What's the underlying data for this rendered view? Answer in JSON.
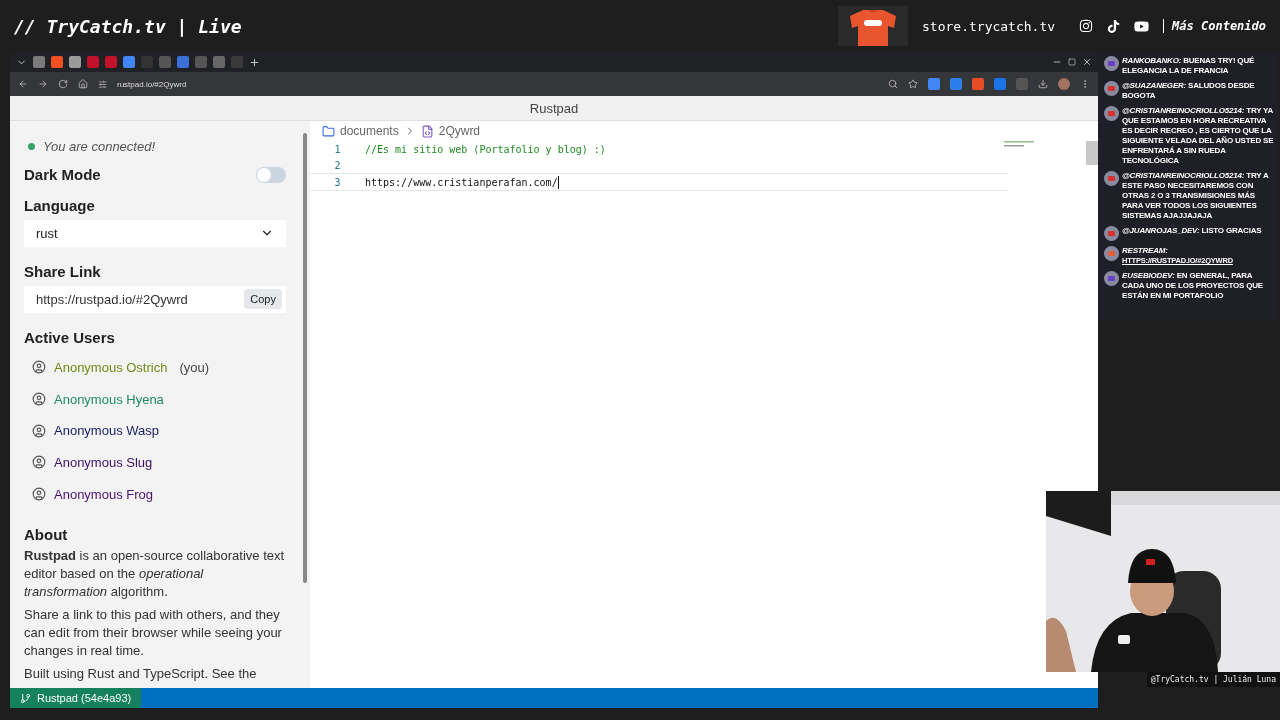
{
  "stream_header": {
    "title": "// TryCatch.tv | Live",
    "store": "store.trycatch.tv",
    "more": "Más Contenido"
  },
  "browser": {
    "address": "rustpad.io/#2Qywrd",
    "page_title": "Rustpad"
  },
  "sidebar": {
    "connection": {
      "text": "You are connected!",
      "connected": true
    },
    "dark_mode": {
      "label": "Dark Mode",
      "on": false
    },
    "language": {
      "label": "Language",
      "value": "rust"
    },
    "share_link": {
      "label": "Share Link",
      "value": "https://rustpad.io/#2Qywrd",
      "button": "Copy"
    },
    "active_users": {
      "label": "Active Users",
      "users": [
        {
          "name": "Anonymous Ostrich",
          "suffix": "(you)",
          "color": "#6e8a14"
        },
        {
          "name": "Anonymous Hyena",
          "color": "#1f8a6c"
        },
        {
          "name": "Anonymous Wasp",
          "color": "#1c1c66"
        },
        {
          "name": "Anonymous Slug",
          "color": "#3a1468"
        },
        {
          "name": "Anonymous Frog",
          "color": "#4c1470"
        }
      ]
    },
    "about": {
      "title": "About",
      "paragraphs": [
        "**Rustpad** is an open-source collaborative text editor based on the *operational transformation* algorithm.",
        "Share a link to this pad with others, and they can edit from their browser while seeing your changes in real time.",
        "Built using Rust and TypeScript. See the"
      ]
    }
  },
  "editor": {
    "breadcrumb": [
      "documents",
      "2Qywrd"
    ],
    "lines": [
      {
        "number": "1",
        "text": "//Es mi sitio web (Portafolio y blog) :)",
        "kind": "comment",
        "current": false
      },
      {
        "number": "2",
        "current": false
      },
      {
        "number": "3",
        "text": "https://www.cristianperafan.com/",
        "kind": "plain",
        "current": true
      }
    ]
  },
  "status_bar": {
    "label": "Rustpad (54e4a93)"
  },
  "chat": [
    {
      "user": "RANKOBANKO:",
      "text": "BUENAS TRY! QUÉ ELEGANCIA LA DE FRANCIA",
      "color": "#6a3fc8"
    },
    {
      "user": "@SUAZANEGER:",
      "text": "SALUDOS DESDE BOGOTA",
      "color": "#d8312b"
    },
    {
      "user": "@CRISTIANREINOCRIOLLO5214:",
      "text": "TRY YA QUE ESTAMOS EN HORA RECREATIVA ES DECIR RECREO , ES CIERTO QUE LA SIGUIENTE VELADA DEL AÑO USTED SE ENFRENTARÁ A SIN RUEDA TECNOLÓGICA",
      "color": "#d8312b"
    },
    {
      "user": "@CRISTIANREINOCRIOLLO5214:",
      "text": "TRY A ESTE PASO NECESITAREMOS CON OTRAS 2 O 3 TRANSMISIONES MÁS PARA VER TODOS LOS SIGUIENTES SISTEMAS AJAJJAJAJA",
      "color": "#d8312b"
    },
    {
      "user": "@JUANROJAS_DEV:",
      "text": "LISTO GRACIAS",
      "color": "#d8312b"
    },
    {
      "user": "RESTREAM:",
      "link": "HTTPS://RUSTPAD.IO/#2QYWRD",
      "color": "#e0603a"
    },
    {
      "user": "EUSEBIODEV:",
      "text": "EN GENERAL, PARA CADA UNO DE LOS PROYECTOS QUE ESTÁN EN MI PORTAFOLIO",
      "color": "#6a3fc8"
    }
  ],
  "webcam": {
    "kind": "picture",
    "caption": "@TryCatch.tv | Julián Luna"
  }
}
